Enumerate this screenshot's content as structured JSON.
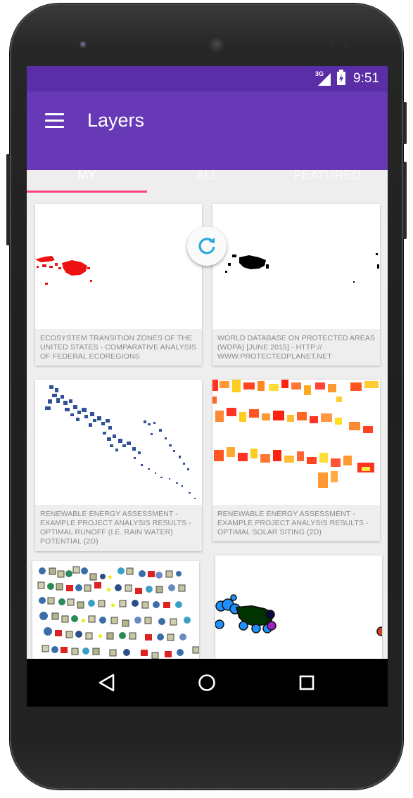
{
  "status_bar": {
    "network": "3G",
    "time": "9:51"
  },
  "app_bar": {
    "title": "Layers"
  },
  "tabs": [
    {
      "label": "MY"
    },
    {
      "label": "ALL"
    },
    {
      "label": "FEATURED"
    }
  ],
  "layers": [
    {
      "caption": "ECOSYSTEM TRANSITION ZONES OF THE UNITED STATES - COMPARATIVE ANALYSIS OF FEDERAL ECOREGIONS"
    },
    {
      "caption": "WORLD DATABASE ON PROTECTED AREAS (WDPA) [JUNE 2015] - HTTP:// WWW.PROTECTEDPLANET.NET"
    },
    {
      "caption": "RENEWABLE ENERGY ASSESSMENT - EXAMPLE PROJECT ANALYSIS RESULTS - OPTIMAL RUNOFF (I.E. RAIN WATER) POTENTIAL  (2D)"
    },
    {
      "caption": "RENEWABLE ENERGY ASSESSMENT - EXAMPLE PROJECT ANALYSIS RESULTS - OPTIMAL SOLAR SITING (2D)"
    },
    {
      "caption": ""
    },
    {
      "caption": ""
    }
  ],
  "icons": {
    "menu": "hamburger-menu-icon",
    "refresh": "refresh-icon",
    "back": "back-triangle-icon",
    "home": "home-circle-icon",
    "recents": "recents-square-icon"
  },
  "colors": {
    "status_bar": "#5a2ea6",
    "app_bar": "#6739b6",
    "tab_indicator": "#ff4081",
    "refresh_accent": "#29a8e0"
  }
}
